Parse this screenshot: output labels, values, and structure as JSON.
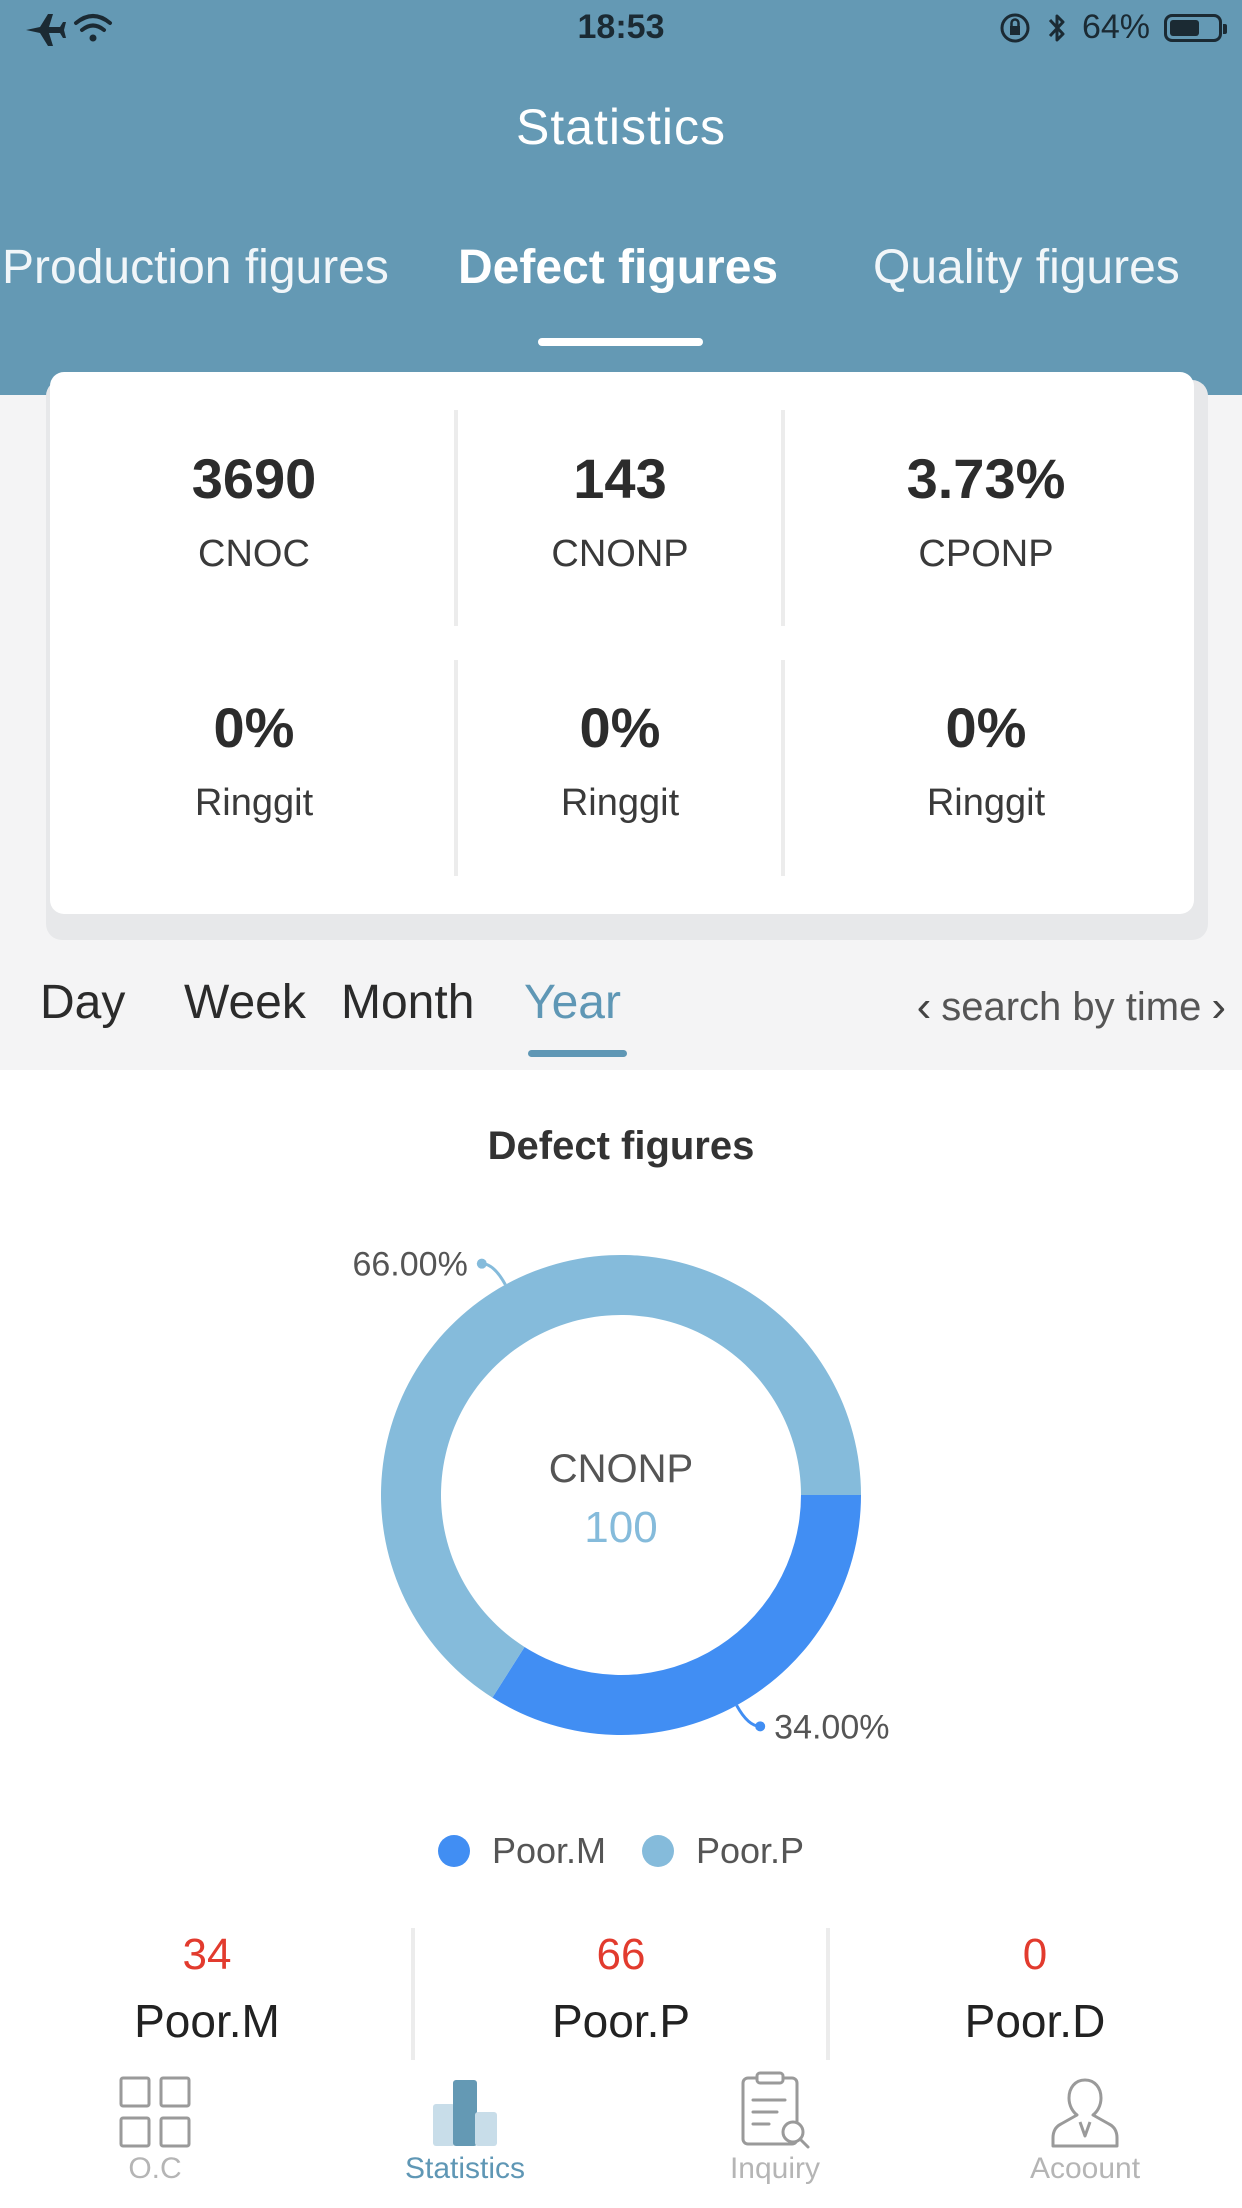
{
  "status_bar": {
    "time": "18:53",
    "battery_pct": "64%",
    "battery_level": 0.64
  },
  "header": {
    "title": "Statistics"
  },
  "top_tabs": [
    {
      "label": "Production figures",
      "active": false
    },
    {
      "label": "Defect figures",
      "active": true
    },
    {
      "label": "Quality figures",
      "active": false
    }
  ],
  "stats": [
    {
      "value": "3690",
      "label": "CNOC"
    },
    {
      "value": "143",
      "label": "CNONP"
    },
    {
      "value": "3.73%",
      "label": "CPONP"
    },
    {
      "value": "0%",
      "label": "Ringgit"
    },
    {
      "value": "0%",
      "label": "Ringgit"
    },
    {
      "value": "0%",
      "label": "Ringgit"
    }
  ],
  "periods": [
    {
      "label": "Day",
      "active": false
    },
    {
      "label": "Week",
      "active": false
    },
    {
      "label": "Month",
      "active": false
    },
    {
      "label": "Year",
      "active": true
    }
  ],
  "search_time_label": "search by time",
  "chart_data": {
    "type": "pie",
    "title": "Defect figures",
    "center_label": "CNONP",
    "center_value": "100",
    "series": [
      {
        "name": "Poor.M",
        "value": 34,
        "label": "34.00%",
        "color": "#418ef3"
      },
      {
        "name": "Poor.P",
        "value": 66,
        "label": "66.00%",
        "color": "#85bbdb"
      }
    ]
  },
  "summary": [
    {
      "value": "34",
      "label": "Poor.M"
    },
    {
      "value": "66",
      "label": "Poor.P"
    },
    {
      "value": "0",
      "label": "Poor.D"
    }
  ],
  "tabbar": [
    {
      "label": "O.C",
      "icon": "grid-icon",
      "active": false
    },
    {
      "label": "Statistics",
      "icon": "bar-chart-icon",
      "active": true
    },
    {
      "label": "Inquiry",
      "icon": "clipboard-search-icon",
      "active": false
    },
    {
      "label": "Acoount",
      "icon": "user-icon",
      "active": false
    }
  ],
  "colors": {
    "header": "#6499b4",
    "accent": "#5f97b5",
    "poor_m": "#418ef3",
    "poor_p": "#85bbdb",
    "summary_value": "#e23b2e"
  }
}
